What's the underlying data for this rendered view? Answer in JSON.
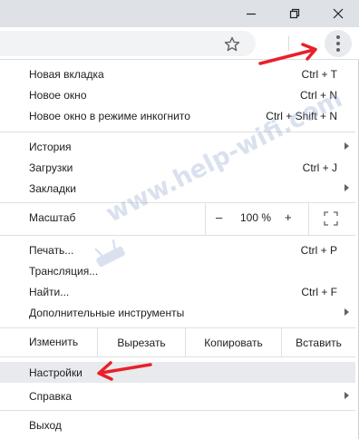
{
  "window": {
    "minimize_icon": "minimize-icon",
    "maximize_icon": "restore-icon",
    "close_icon": "close-icon"
  },
  "toolbar": {
    "bookmark_icon": "star-icon",
    "menu_icon": "kebab-menu-icon"
  },
  "menu": {
    "group1": [
      {
        "label": "Новая вкладка",
        "shortcut": "Ctrl + T"
      },
      {
        "label": "Новое окно",
        "shortcut": "Ctrl + N"
      },
      {
        "label": "Новое окно в режиме инкогнито",
        "shortcut": "Ctrl + Shift + N"
      }
    ],
    "group2": [
      {
        "label": "История",
        "submenu": true
      },
      {
        "label": "Загрузки",
        "shortcut": "Ctrl + J"
      },
      {
        "label": "Закладки",
        "submenu": true
      }
    ],
    "zoom": {
      "label": "Масштаб",
      "minus": "–",
      "value": "100 %",
      "plus": "+",
      "fullscreen_icon": "fullscreen-icon"
    },
    "group3": [
      {
        "label": "Печать...",
        "shortcut": "Ctrl + P"
      },
      {
        "label": "Трансляция..."
      },
      {
        "label": "Найти...",
        "shortcut": "Ctrl + F"
      },
      {
        "label": "Дополнительные инструменты",
        "submenu": true
      }
    ],
    "edit": {
      "label": "Изменить",
      "cut": "Вырезать",
      "copy": "Копировать",
      "paste": "Вставить"
    },
    "group4": [
      {
        "label": "Настройки",
        "highlighted": true
      },
      {
        "label": "Справка",
        "submenu": true
      }
    ],
    "group5": [
      {
        "label": "Выход"
      }
    ]
  },
  "watermark": {
    "text": "www.help-wifi.com"
  },
  "annotations": {
    "arrow_color": "#e8202a"
  }
}
